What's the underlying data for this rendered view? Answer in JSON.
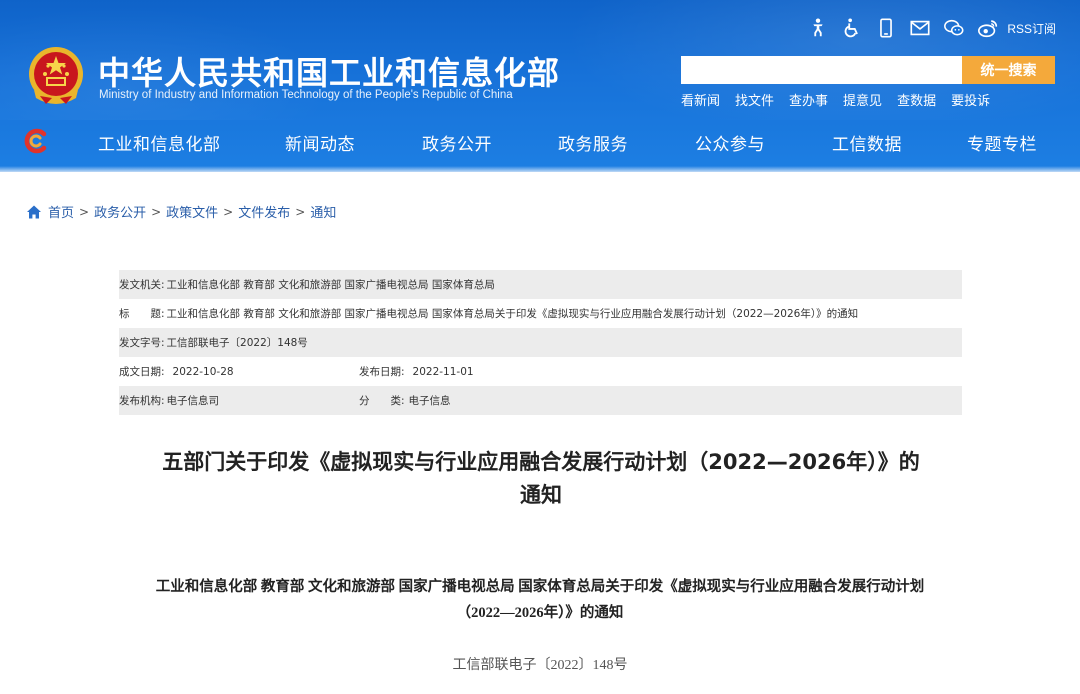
{
  "header": {
    "site_title": "中华人民共和国工业和信息化部",
    "site_subtitle": "Ministry of Industry and Information Technology of the People's Republic of China",
    "util_icons": [
      "accessibility-figure-icon",
      "wheelchair-icon",
      "mobile-phone-icon",
      "mail-icon",
      "wechat-icon",
      "weibo-icon"
    ],
    "rss_label": "RSS订阅",
    "search": {
      "placeholder": "",
      "button_label": "统一搜索"
    },
    "quick_links": [
      "看新闻",
      "找文件",
      "查办事",
      "提意见",
      "查数据",
      "要投诉"
    ],
    "colors": {
      "header_blue": "#1772d9",
      "search_button": "#f4a93b"
    }
  },
  "nav": {
    "items": [
      "工业和信息化部",
      "新闻动态",
      "政务公开",
      "政务服务",
      "公众参与",
      "工信数据",
      "专题专栏"
    ]
  },
  "breadcrumb": {
    "items": [
      "首页",
      "政务公开",
      "政策文件",
      "文件发布",
      "通知"
    ],
    "separator": ">"
  },
  "meta": {
    "issuer_key": "发文机关:",
    "issuer_val": "工业和信息化部 教育部 文化和旅游部 国家广播电视总局 国家体育总局",
    "title_key": "标　　题:",
    "title_val": "工业和信息化部 教育部 文化和旅游部 国家广播电视总局 国家体育总局关于印发《虚拟现实与行业应用融合发展行动计划（2022—2026年）》的通知",
    "docno_key": "发文字号:",
    "docno_val": "工信部联电子〔2022〕148号",
    "created_key": "成文日期:",
    "created_val": "2022-10-28",
    "published_key": "发布日期:",
    "published_val": "2022-11-01",
    "agency_key": "发布机构:",
    "agency_val": "电子信息司",
    "category_key": "分　　类:",
    "category_val": "电子信息"
  },
  "article": {
    "title_line1": "五部门关于印发《虚拟现实与行业应用融合发展行动计划（2022—2026年）》的",
    "title_line2": "通知",
    "body_heading_line1": "工业和信息化部 教育部 文化和旅游部 国家广播电视总局 国家体育总局关于印发《虚拟现实与行业应用融合发展行动计划",
    "body_heading_line2": "（2022—2026年）》的通知",
    "doc_number": "工信部联电子〔2022〕148号"
  }
}
